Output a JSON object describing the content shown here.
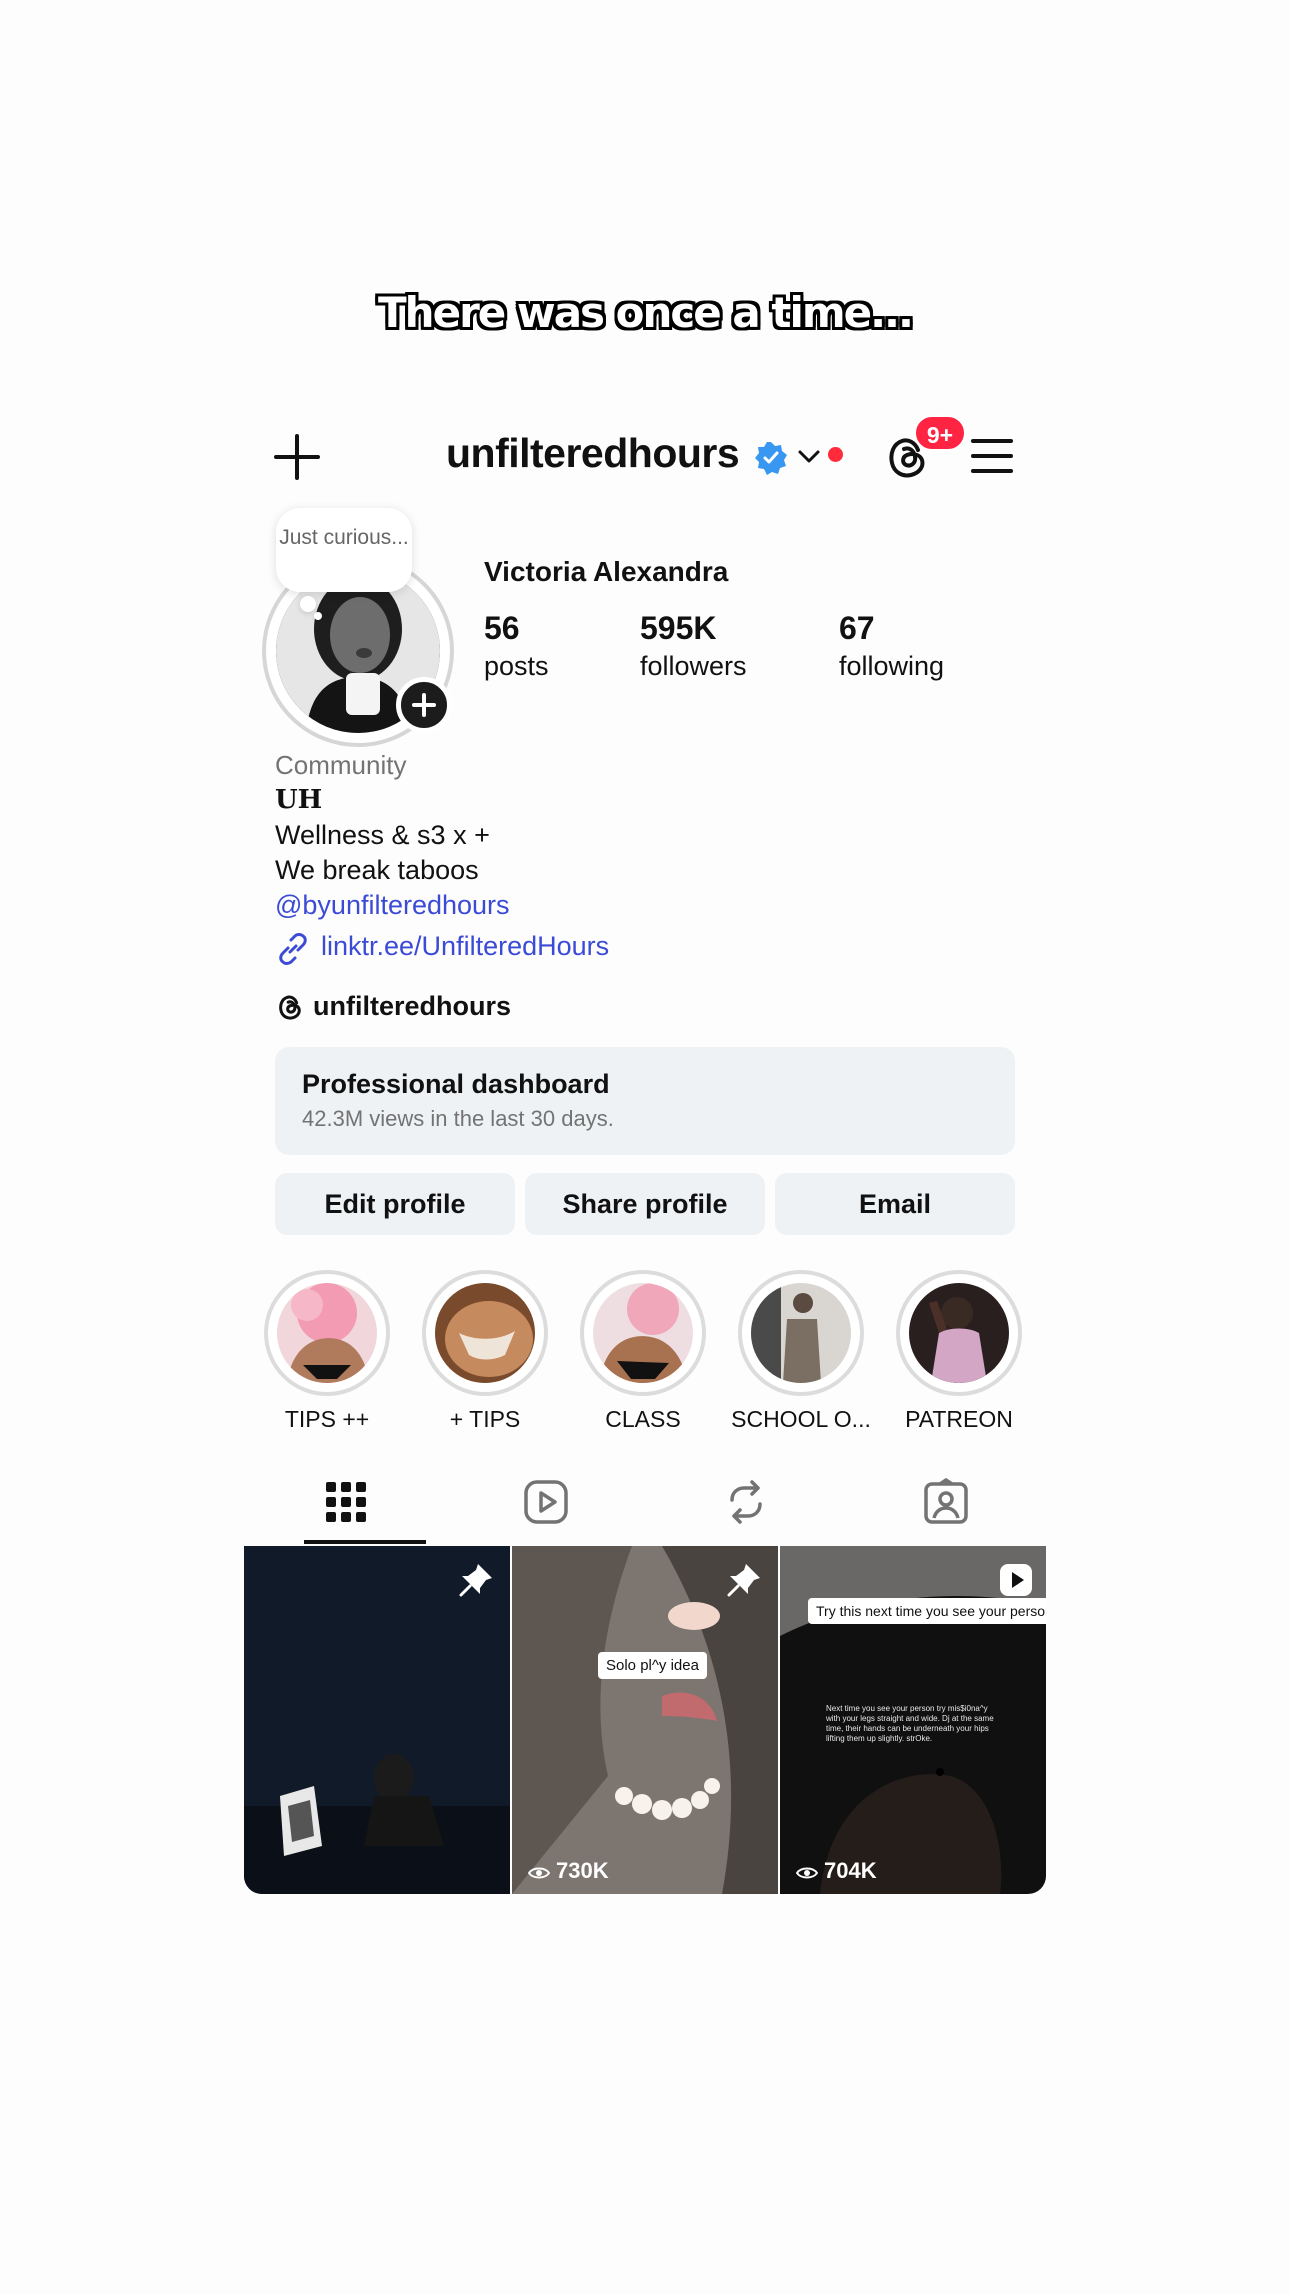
{
  "caption": "There was once a time...",
  "topbar": {
    "username": "unfilteredhours",
    "notifications_badge": "9+",
    "icons": [
      "plus-icon",
      "verified-badge-icon",
      "chevron-down-icon",
      "threads-icon",
      "menu-icon"
    ]
  },
  "profile": {
    "note": "Just curious...",
    "full_name": "Victoria Alexandra",
    "stats": {
      "posts": {
        "count": "56",
        "label": "posts"
      },
      "followers": {
        "count": "595K",
        "label": "followers"
      },
      "following": {
        "count": "67",
        "label": "following"
      }
    }
  },
  "bio": {
    "category": "Community",
    "title": "UH",
    "line1": "Wellness & s3 x +",
    "line2": "We break taboos",
    "mention": "@byunfilteredhours",
    "link": "linktr.ee/UnfilteredHours",
    "threads_handle": "unfilteredhours"
  },
  "dashboard": {
    "title": "Professional dashboard",
    "subtitle": "42.3M views in the last 30 days."
  },
  "buttons": {
    "edit": "Edit profile",
    "share": "Share profile",
    "email": "Email"
  },
  "highlights": [
    {
      "label": "TIPS ++"
    },
    {
      "label": "+ TIPS"
    },
    {
      "label": "CLASS"
    },
    {
      "label": "SCHOOL O..."
    },
    {
      "label": "PATREON"
    }
  ],
  "tabs": [
    "grid-icon",
    "reels-icon",
    "reposts-icon",
    "tagged-icon"
  ],
  "posts": [
    {
      "pinned": true,
      "views": ""
    },
    {
      "pinned": true,
      "views": "730K",
      "overlay_text": "Solo pl^y idea"
    },
    {
      "pinned": false,
      "views": "704K",
      "overlay_text": "Try this next time you see your person",
      "body_text": "Next time you see your person try mis$i0na^y with your legs straight and wide. Dj at the same time, their hands can be underneath your hips lifting them up slightly. strOke."
    }
  ],
  "colors": {
    "link_blue": "#3b4bd6",
    "verified_blue": "#3897f0",
    "badge_red": "#ff2442",
    "button_bg": "#eff2f5"
  }
}
